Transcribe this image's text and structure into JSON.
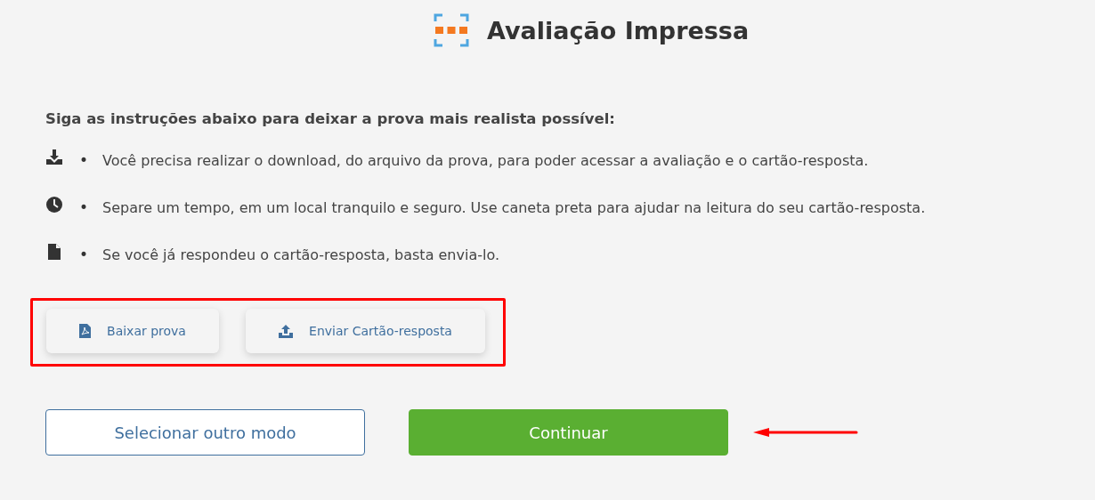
{
  "header": {
    "title": "Avaliação Impressa"
  },
  "instructions": {
    "heading": "Siga as instruções abaixo para deixar a prova mais realista possível:",
    "items": [
      {
        "kind": "download",
        "bullet": "•",
        "text": "Você precisa realizar o download, do arquivo da prova, para poder acessar a avaliação e o cartão-resposta."
      },
      {
        "kind": "clock",
        "bullet": "•",
        "text": "Separe um tempo, em um local tranquilo e seguro. Use caneta preta para ajudar na leitura do seu cartão-resposta."
      },
      {
        "kind": "file",
        "bullet": "•",
        "text": "Se você já respondeu o cartão-resposta, basta envia-lo."
      }
    ]
  },
  "file_buttons": [
    {
      "kind": "pdf",
      "label": "Baixar prova"
    },
    {
      "kind": "upload",
      "label": "Enviar Cartão-resposta"
    }
  ],
  "actions": [
    {
      "kind": "outline",
      "label": "Selecionar outro modo"
    },
    {
      "kind": "primary",
      "label": "Continuar"
    }
  ]
}
